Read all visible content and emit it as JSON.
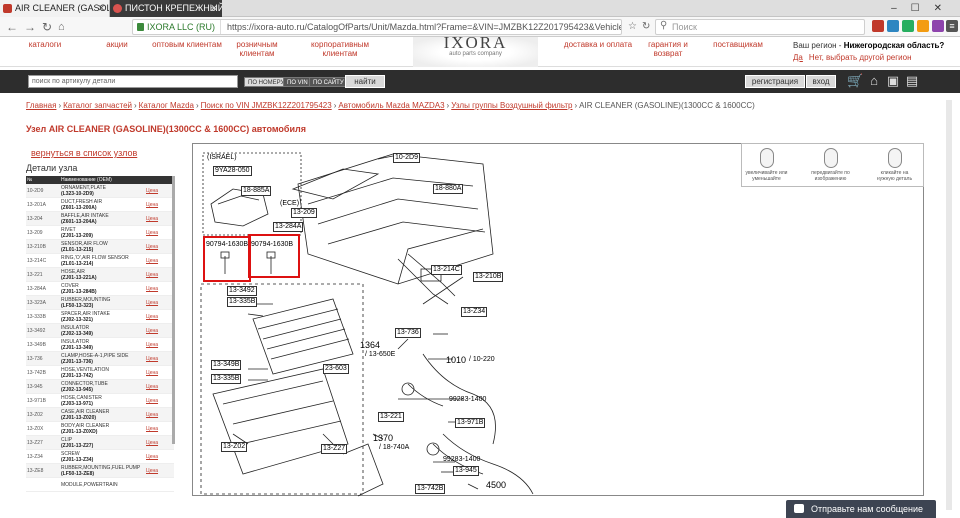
{
  "browser": {
    "tabs": [
      {
        "label": "AIR CLEANER (GASOLINE)(13"
      },
      {
        "label": "ПИСТОН КРЕПЕЖНЫЙ | MAZ"
      }
    ],
    "site_badge": "IXORA LLC (RU)",
    "url": "https://ixora-auto.ru/CatalogOfParts/Unit/Mazda.html?Frame=&VIN=JMZBK12Z201795423&VehicleId=1421649725&Wi...",
    "search_placeholder": "Поиск",
    "back_icon": "back-arrow-icon",
    "forward_icon": "forward-arrow-icon"
  },
  "site": {
    "nav": [
      {
        "label": "каталоги"
      },
      {
        "label": "акции"
      },
      {
        "label": "оптовым клиентам"
      },
      {
        "label": "розничным клиентам"
      },
      {
        "label": "корпоративным клиентам"
      },
      {
        "label": "доставка и оплата"
      },
      {
        "label": "гарантия и возврат"
      },
      {
        "label": "поставщикам"
      }
    ],
    "logo_text": "IXORA",
    "logo_sub": "auto parts company",
    "region": {
      "title": "Ваш регион -",
      "value": "Нижегородская область?",
      "yes": "Да",
      "other": "Нет, выбрать другой регион"
    },
    "search": {
      "placeholder": "поиск по артикулу детали",
      "tabs": [
        "ПО НОМЕРУ",
        "ПО VIN",
        "ПО САЙТУ"
      ],
      "button": "найти"
    },
    "register": "регистрация",
    "login": "вход"
  },
  "breadcrumbs": [
    "Главная",
    "Каталог запчастей",
    "Каталог Mazda",
    "Поиск по VIN JMZBK12Z201795423",
    "Автомобиль Mazda MAZDA3",
    "Узлы группы Воздушный фильтр"
  ],
  "breadcrumb_current": "AIR CLEANER (GASOLINE)(1300CC & 1600CC)",
  "page_title": "Узел AIR CLEANER (GASOLINE)(1300CC & 1600CC) автомобиля",
  "back_link": "вернуться в список узлов",
  "parts": {
    "heading": "Детали узла",
    "columns": [
      "№",
      "Наименование (OEM)",
      ""
    ],
    "rows": [
      {
        "no": "10-2D9",
        "name": "ORNAMENT,PLATE",
        "oem": "(L323-10-2D9)",
        "price": "Цена"
      },
      {
        "no": "13-201A",
        "name": "DUCT,FRESH AIR",
        "oem": "(Z601-13-200A)",
        "price": "Цена"
      },
      {
        "no": "13-204",
        "name": "BAFFLE,AIR INTAKE",
        "oem": "(Z601-13-204A)",
        "price": "Цена"
      },
      {
        "no": "13-209",
        "name": "RIVET",
        "oem": "(ZJ01-13-209)",
        "price": "Цена"
      },
      {
        "no": "13-210B",
        "name": "SENSOR,AIR FLOW",
        "oem": "(ZL01-13-215)",
        "price": "Цена"
      },
      {
        "no": "13-214C",
        "name": "RING,'O',AIR FLOW SENSOR",
        "oem": "(ZL01-13-214)",
        "price": "Цена"
      },
      {
        "no": "13-221",
        "name": "HOSE,AIR",
        "oem": "(ZJ01-13-221A)",
        "price": "Цена"
      },
      {
        "no": "13-284A",
        "name": "COVER",
        "oem": "(ZJ01-13-284B)",
        "price": "Цена"
      },
      {
        "no": "13-323A",
        "name": "RUBBER,MOUNTING",
        "oem": "(LF50-13-323)",
        "price": "Цена"
      },
      {
        "no": "13-333B",
        "name": "SPACER,AIR INTAKE",
        "oem": "(ZJ02-13-321)",
        "price": "Цена"
      },
      {
        "no": "13-3492",
        "name": "INSULATOR",
        "oem": "(ZJ02-13-349)",
        "price": "Цена"
      },
      {
        "no": "13-349B",
        "name": "INSULATOR",
        "oem": "(ZJ01-13-349)",
        "price": "Цена"
      },
      {
        "no": "13-736",
        "name": "CLAMP,HOSE-A-1,PIPE SIDE",
        "oem": "(ZJ01-13-736)",
        "price": "Цена"
      },
      {
        "no": "13-742B",
        "name": "HOSE,VENTILATION",
        "oem": "(ZJ01-13-742)",
        "price": "Цена"
      },
      {
        "no": "13-945",
        "name": "CONNECTOR,TUBE",
        "oem": "(ZJ02-13-945)",
        "price": "Цена"
      },
      {
        "no": "13-971B",
        "name": "HOSE,CANISTER",
        "oem": "(ZJ03-13-971)",
        "price": "Цена"
      },
      {
        "no": "13-Z02",
        "name": "CASE,AIR CLEANER",
        "oem": "(ZJ01-13-Z020)",
        "price": "Цена"
      },
      {
        "no": "13-Z0X",
        "name": "BODY,AIR CLEANER",
        "oem": "(ZJ01-13-Z0XD)",
        "price": "Цена"
      },
      {
        "no": "13-Z27",
        "name": "CLIP",
        "oem": "(ZJ01-13-Z27)",
        "price": "Цена"
      },
      {
        "no": "13-Z34",
        "name": "SCREW",
        "oem": "(ZJ01-13-Z34)",
        "price": "Цена"
      },
      {
        "no": "13-ZE8",
        "name": "RUBBER,MOUNTING,FUEL PUMP",
        "oem": "(LF50-13-ZE8)",
        "price": "Цена"
      },
      {
        "no": "",
        "name": "MODULE,POWERTRAIN",
        "oem": "",
        "price": ""
      }
    ]
  },
  "diagram": {
    "labels": [
      {
        "text": "(ISRAEL)"
      },
      {
        "text": "9YA28-050"
      },
      {
        "text": "10-2D9"
      },
      {
        "text": "18-885A"
      },
      {
        "text": "18-880A"
      },
      {
        "text": "(ECE)"
      },
      {
        "text": "13-209"
      },
      {
        "text": "13-284A"
      },
      {
        "text": "90794-1630B"
      },
      {
        "text": "90794-1630B"
      },
      {
        "text": "13-214C"
      },
      {
        "text": "13-210B"
      },
      {
        "text": "13-3492"
      },
      {
        "text": "13-335B"
      },
      {
        "text": "13-Z34"
      },
      {
        "text": "13-736"
      },
      {
        "text": "1364"
      },
      {
        "text": "/ 13-650E"
      },
      {
        "text": "1010"
      },
      {
        "text": "/ 10-220"
      },
      {
        "text": "13-349B"
      },
      {
        "text": "13-335B"
      },
      {
        "text": "23-603"
      },
      {
        "text": "99283-1400"
      },
      {
        "text": "13-221"
      },
      {
        "text": "13-971B"
      },
      {
        "text": "1370"
      },
      {
        "text": "/ 18-740A"
      },
      {
        "text": "99283-1400"
      },
      {
        "text": "13-945"
      },
      {
        "text": "13-Z02"
      },
      {
        "text": "13-Z27"
      },
      {
        "text": "13-742B"
      },
      {
        "text": "4500"
      }
    ],
    "controls": [
      {
        "label": "увеличивайте или уменьшайте",
        "icon": "mouse-scroll-icon"
      },
      {
        "label": "передвигайте по изображению",
        "icon": "mouse-drag-icon"
      },
      {
        "label": "кликайте на нужную деталь",
        "icon": "mouse-click-icon"
      }
    ]
  },
  "chat": "Отправьте нам сообщение",
  "colors": {
    "brand": "#c0392b",
    "dark_bar": "#2d2d2d",
    "highlight": "#dd1111"
  }
}
